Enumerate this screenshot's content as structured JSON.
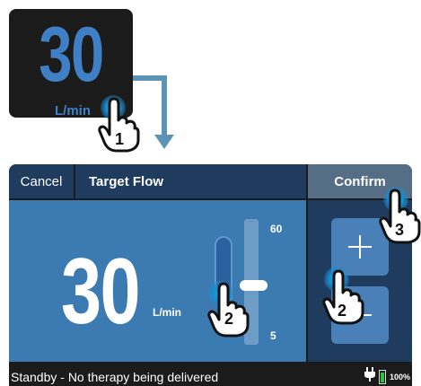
{
  "mini_display": {
    "value": "30",
    "unit": "L/min"
  },
  "header": {
    "cancel_label": "Cancel",
    "title": "Target Flow",
    "confirm_label": "Confirm"
  },
  "main": {
    "value": "30",
    "unit": "L/min",
    "slider": {
      "max_label": "60",
      "min_label": "5",
      "level_fraction": 0.45
    }
  },
  "side": {
    "plus_label": "+",
    "minus_label": "−"
  },
  "status_bar": {
    "text": "Standby - No therapy being delivered",
    "battery_percent": "100%"
  },
  "steps": {
    "step1": "1",
    "step2a": "2",
    "step2b": "2",
    "step3": "3"
  },
  "colors": {
    "accent_blue": "#3c7bb2",
    "header_navy": "#1f3b5e",
    "confirm_gray": "#566d86",
    "value_blue": "#3f7fc6",
    "battery_green": "#27c53e"
  }
}
